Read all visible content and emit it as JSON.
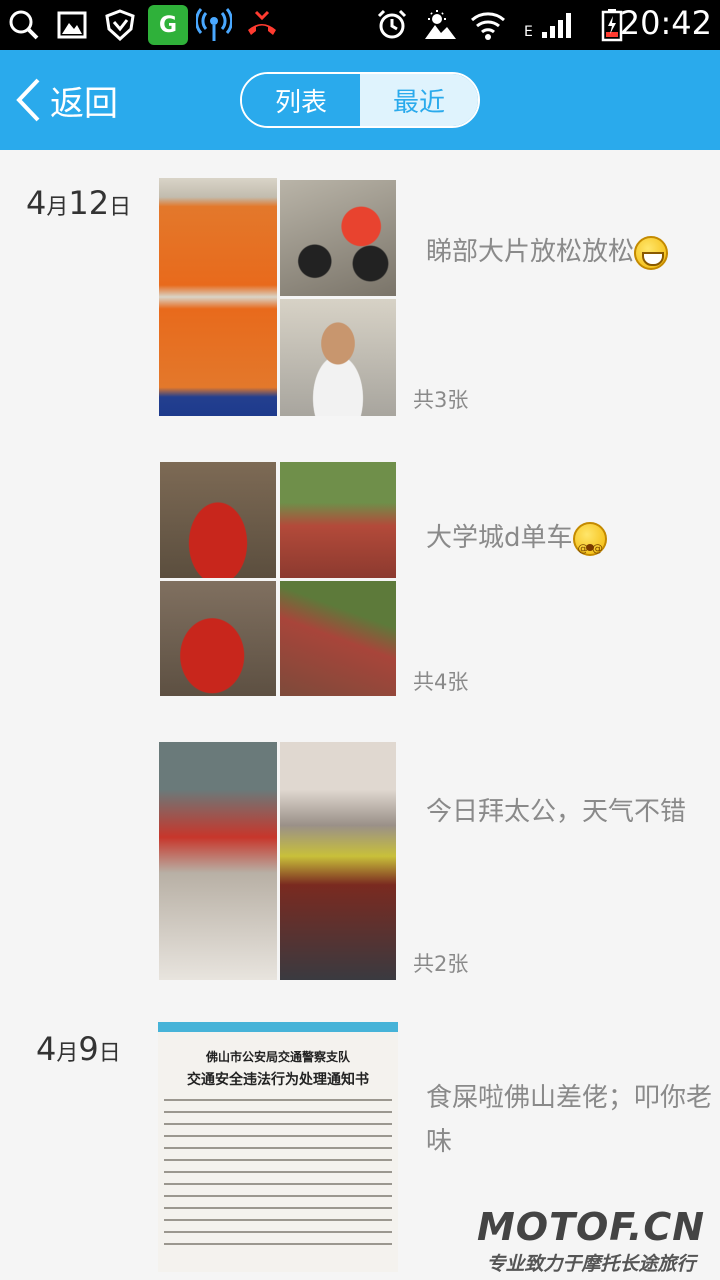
{
  "status_bar": {
    "time": "20:42",
    "network_type": "E",
    "left_icons": [
      "search-icon",
      "gallery-icon",
      "shield-icon",
      "app-green-icon",
      "wireless-signal-icon",
      "missed-call-icon"
    ],
    "right_icons": [
      "alarm-icon",
      "weather-icon",
      "wifi-icon",
      "cell-signal-icon",
      "battery-icon"
    ]
  },
  "header": {
    "back_label": "返回",
    "tabs": [
      {
        "label": "列表",
        "active": false
      },
      {
        "label": "最近",
        "active": true
      }
    ],
    "accent_color": "#2aaaec"
  },
  "entries": [
    {
      "date": {
        "month": "4",
        "month_unit": "月",
        "day": "12",
        "day_unit": "日"
      },
      "caption": "睇部大片放松放松",
      "emoji": "grin-emoji",
      "count": "共3张"
    },
    {
      "date": null,
      "caption": "大学城d单车",
      "emoji": "dizzy-emoji",
      "count": "共4张"
    },
    {
      "date": null,
      "caption": "今日拜太公，天气不错",
      "emoji": null,
      "count": "共2张"
    },
    {
      "date": {
        "month": "4",
        "month_unit": "月",
        "day": "9",
        "day_unit": "日"
      },
      "caption": "食屎啦佛山差佬；叩你老味",
      "emoji": null,
      "count": null,
      "notice": {
        "org": "佛山市公安局交通警察支队",
        "title": "交通安全违法行为处理通知书"
      }
    }
  ],
  "watermark": {
    "logo": "MOTOF.CN",
    "slogan": "专业致力于摩托长途旅行"
  }
}
